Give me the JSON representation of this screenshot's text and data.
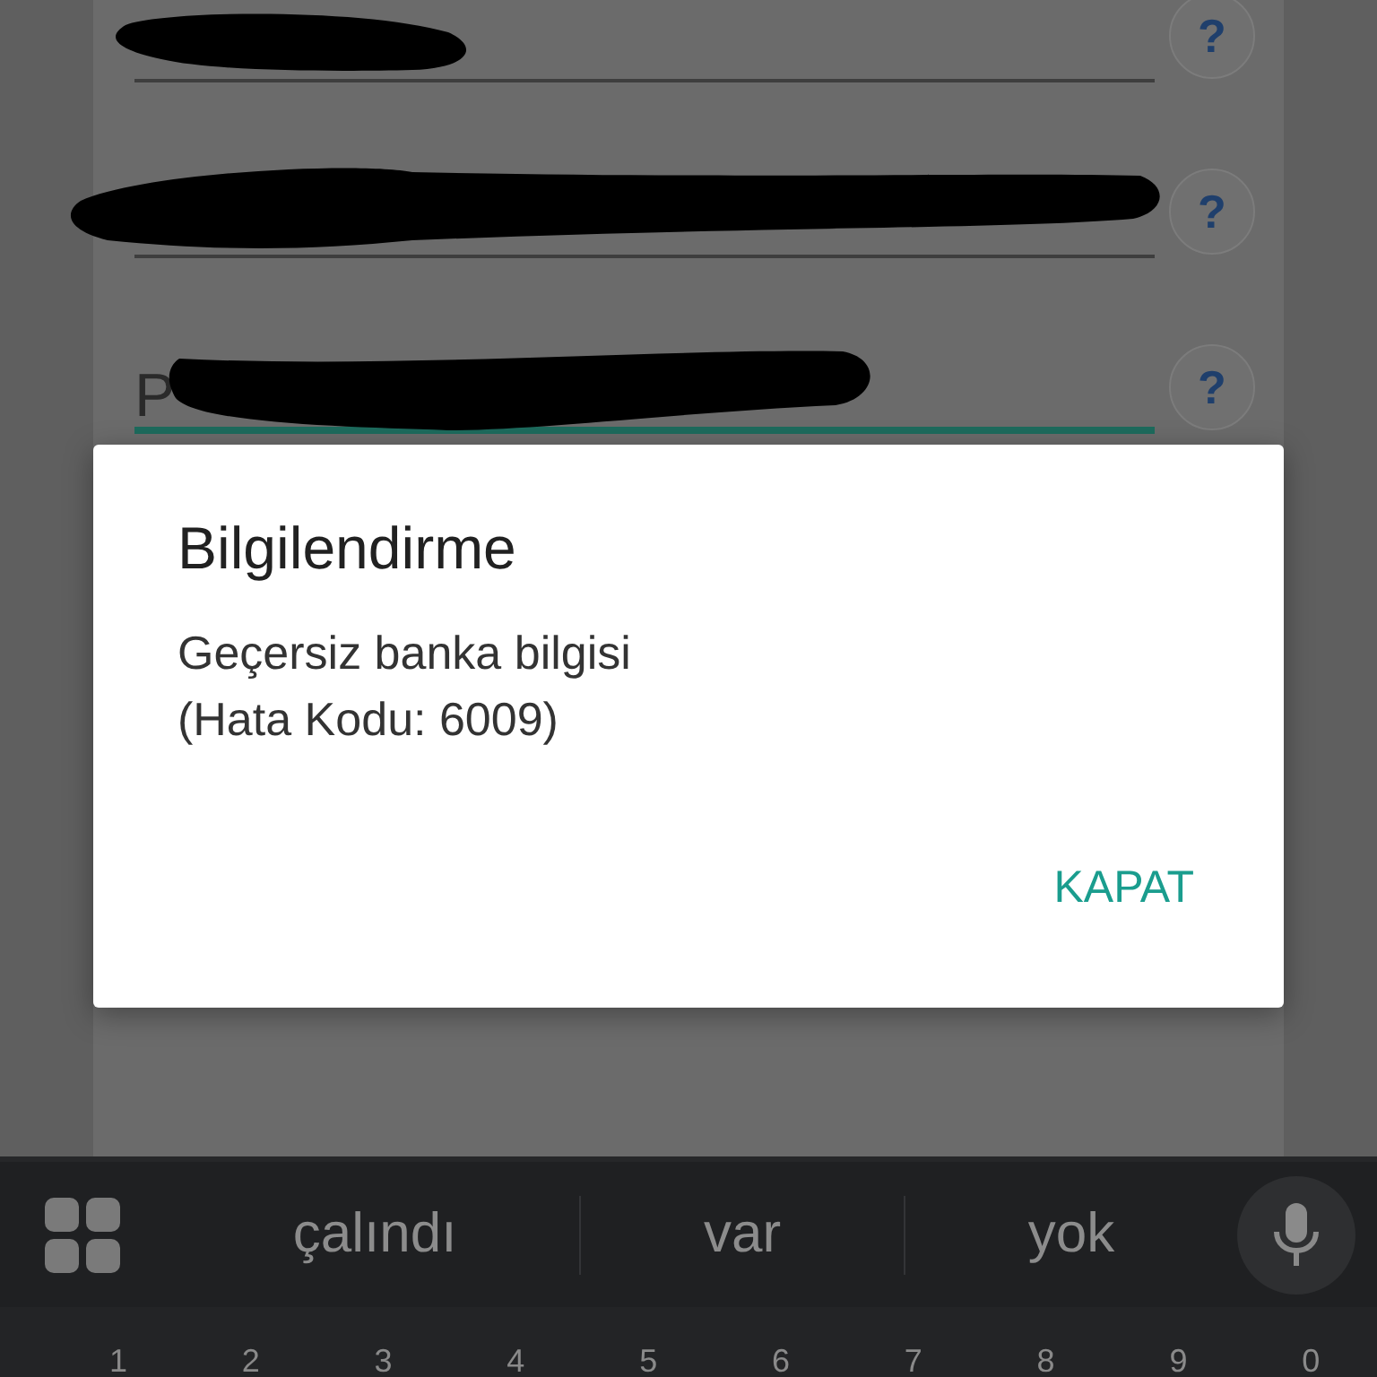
{
  "form": {
    "fields": [
      {
        "focused": false,
        "help": "?"
      },
      {
        "focused": false,
        "help": "?"
      },
      {
        "label": "P",
        "focused": true,
        "help": "?"
      }
    ]
  },
  "dialog": {
    "title": "Bilgilendirme",
    "message": "Geçersiz banka bilgisi\n(Hata Kodu: 6009)",
    "button": "KAPAT"
  },
  "keyboard": {
    "suggestions": [
      "çalındı",
      "var",
      "yok"
    ],
    "number_keys": [
      "1",
      "2",
      "3",
      "4",
      "5",
      "6",
      "7",
      "8",
      "9",
      "0"
    ]
  }
}
